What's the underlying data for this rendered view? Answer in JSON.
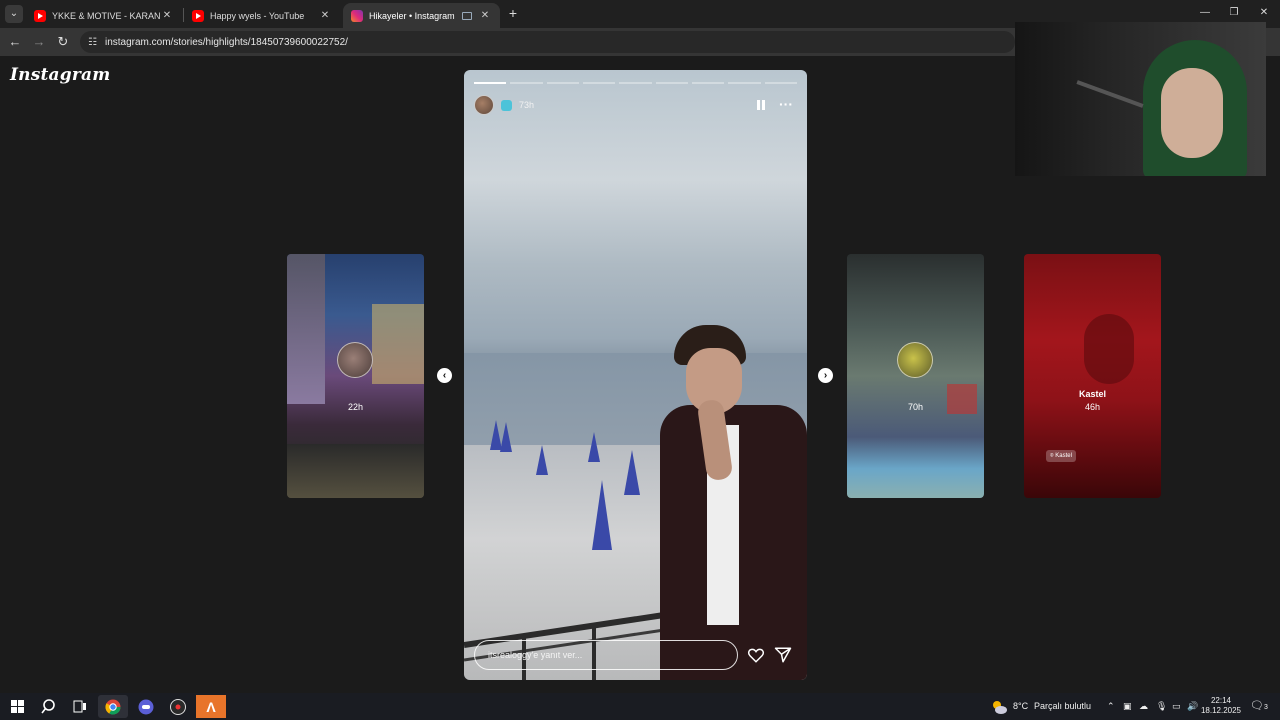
{
  "browser": {
    "tabs": [
      {
        "title": "YKKE & MOTIVE - KARANLIK (O",
        "favicon": "youtube-icon",
        "active": false
      },
      {
        "title": "Happy wyels - YouTube",
        "favicon": "youtube-icon",
        "active": false
      },
      {
        "title": "Hikayeler • Instagram",
        "favicon": "instagram-icon",
        "active": true
      }
    ],
    "url": "instagram.com/stories/highlights/18450739600022752/"
  },
  "instagram": {
    "logo": "Instagram",
    "story": {
      "time": "73h",
      "progress_total": 9,
      "progress_done": 1,
      "reply_placeholder": "itsrealoggy'e yanıt ver..."
    },
    "prev_story": {
      "time": "22h"
    },
    "next_stories": [
      {
        "time": "70h"
      },
      {
        "name": "Kastel",
        "time": "46h",
        "location": "Kastel"
      }
    ]
  },
  "taskbar": {
    "weather_temp": "8°C",
    "weather_text": "Parçalı bulutlu",
    "time": "22:14",
    "date": "18.12.2025",
    "notifications": "3"
  },
  "colors": {
    "page_bg": "#1b1b1b",
    "accent_red": "#ff0000",
    "instagram_gradient": [
      "#f58529",
      "#dd2a7b",
      "#8134af"
    ]
  }
}
